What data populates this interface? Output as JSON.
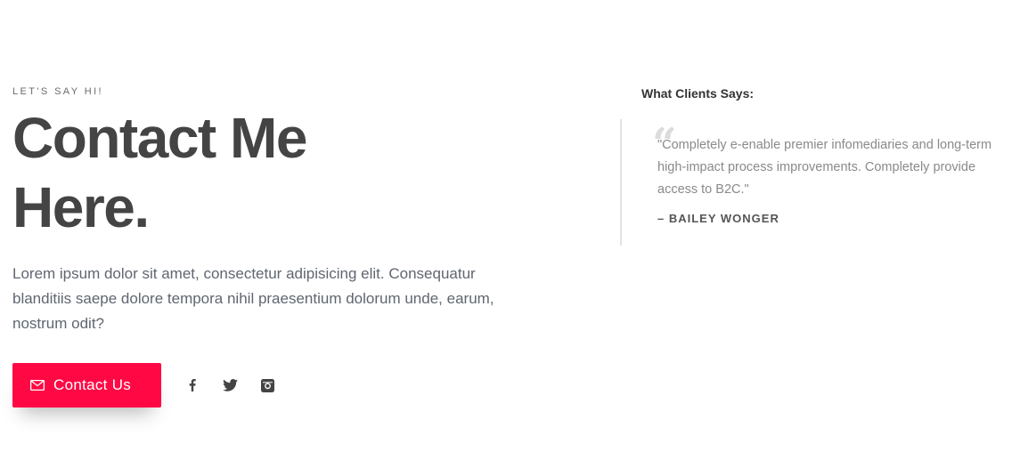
{
  "hero": {
    "eyebrow": "LET'S SAY HI!",
    "headline": "Contact Me Here.",
    "lead": "Lorem ipsum dolor sit amet, consectetur adipisicing elit. Consequatur blanditiis saepe dolore tempora nihil praesentium dolorum unde, earum, nostrum odit?",
    "cta_label": "Contact Us",
    "cta_icon": "envelope-icon",
    "socials": [
      {
        "icon": "facebook-icon"
      },
      {
        "icon": "twitter-icon"
      },
      {
        "icon": "instagram-icon"
      }
    ]
  },
  "testimonials": {
    "title": "What Clients Says:",
    "quote": "Completely e-enable premier infomediaries and long-term high-impact process improvements. Completely provide access to B2C.",
    "quote_display": "\"Completely e-enable premier infomediaries and long-term high-impact process improvements. Completely provide access to B2C.\"",
    "author": "– BAILEY WONGER"
  },
  "colors": {
    "accent": "#ff0844",
    "heading": "#444444",
    "body_text": "#5f6670",
    "quote_text": "#8a8a8a",
    "divider": "#e3e3e3"
  }
}
